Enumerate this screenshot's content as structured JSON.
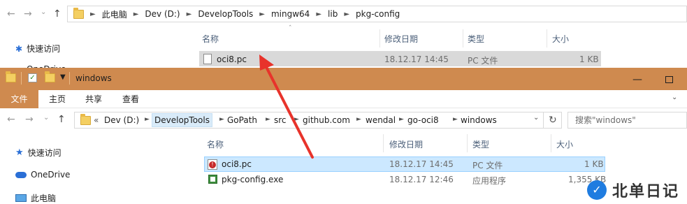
{
  "back_window": {
    "address_crumbs": [
      "此电脑",
      "Dev (D:)",
      "DevelopTools",
      "mingw64",
      "lib",
      "pkg-config"
    ],
    "sidebar": [
      {
        "label": "快速访问",
        "icon": "pin-star-icon"
      }
    ],
    "columns": [
      "名称",
      "修改日期",
      "类型",
      "大小"
    ],
    "files": [
      {
        "name": "oci8.pc",
        "date": "18.12.17 14:45",
        "type": "PC 文件",
        "size": "1 KB",
        "selected": true
      }
    ]
  },
  "front_window": {
    "title": "windows",
    "ribbon_tabs": [
      "文件",
      "主页",
      "共享",
      "查看"
    ],
    "address_crumbs": [
      "Dev (D:)",
      "DevelopTools",
      "GoPath",
      "src",
      "github.com",
      "wendal",
      "go-oci8",
      "windows"
    ],
    "address_overflow": "«",
    "search_placeholder": "搜索\"windows\"",
    "sidebar": [
      {
        "label": "快速访问",
        "icon": "star-icon"
      },
      {
        "label": "OneDrive",
        "icon": "cloud-icon"
      },
      {
        "label": "此电脑",
        "icon": "computer-icon"
      }
    ],
    "columns": [
      "名称",
      "修改日期",
      "类型",
      "大小"
    ],
    "files": [
      {
        "name": "oci8.pc",
        "date": "18.12.17 14:45",
        "type": "PC 文件",
        "size": "1 KB",
        "selected": true,
        "icon": "warning-file-icon"
      },
      {
        "name": "pkg-config.exe",
        "date": "18.12.17 12:46",
        "type": "应用程序",
        "size": "1,355 KB",
        "selected": false,
        "icon": "exe-file-icon"
      }
    ]
  },
  "annotation": {
    "type": "red-arrow",
    "from": "front oci8.pc",
    "to": "back oci8.pc"
  },
  "watermark": {
    "logo": "✓",
    "text": "北单日记"
  },
  "colors": {
    "accent": "#cf8a4f",
    "selection": "#cce8ff",
    "arrow": "#e8332b"
  }
}
